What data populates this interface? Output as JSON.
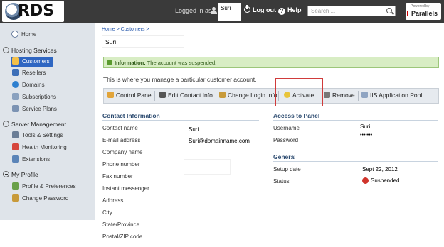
{
  "header": {
    "logo": "RDS",
    "logged_in_as": "Logged in as",
    "username": "Suri",
    "logout": "Log out",
    "help": "Help",
    "search_placeholder": "Search ...",
    "powered_by": "Powered by",
    "brand": "Parallels"
  },
  "sidebar": {
    "home": "Home",
    "hosting_services": "Hosting Services",
    "customers": "Customers",
    "resellers": "Resellers",
    "domains": "Domains",
    "subscriptions": "Subscriptions",
    "service_plans": "Service Plans",
    "server_management": "Server Management",
    "tools_settings": "Tools & Settings",
    "health_monitoring": "Health Monitoring",
    "extensions": "Extensions",
    "my_profile": "My Profile",
    "profile_preferences": "Profile & Preferences",
    "change_password": "Change Password"
  },
  "main": {
    "breadcrumb": "Home > Customers >",
    "customer_name": "Suri",
    "info_label": "Information:",
    "info_text": "The account was suspended.",
    "manage_text": "This is where you manage a particular customer account.",
    "toolbar": {
      "control_panel": "Control Panel",
      "edit_contact": "Edit Contact Info",
      "change_login": "Change Login Info",
      "activate": "Activate",
      "remove": "Remove",
      "iis_pool": "IIS Application Pool"
    },
    "contact": {
      "title": "Contact Information",
      "contact_name_label": "Contact name",
      "contact_name": "Suri",
      "email_label": "E-mail address",
      "email": "Suri@domainname.com",
      "company_label": "Company name",
      "phone_label": "Phone number",
      "fax_label": "Fax number",
      "im_label": "Instant messenger",
      "address_label": "Address",
      "city_label": "City",
      "state_label": "State/Province",
      "zip_label": "Postal/ZIP code"
    },
    "access": {
      "title": "Access to Panel",
      "username_label": "Username",
      "username": "Suri",
      "password_label": "Password",
      "password": "•••••••"
    },
    "general": {
      "title": "General",
      "setup_label": "Setup date",
      "setup_date": "Sept 22, 2012",
      "status_label": "Status",
      "status": "Suspended"
    }
  },
  "colors": {
    "header_bg": "#3a3a3a",
    "sidebar_bg": "#dfe4ea",
    "active_item": "#2f66c2",
    "info_bg": "#d8edc4",
    "highlight_border": "#d03b3b",
    "status_red": "#d0342c"
  }
}
